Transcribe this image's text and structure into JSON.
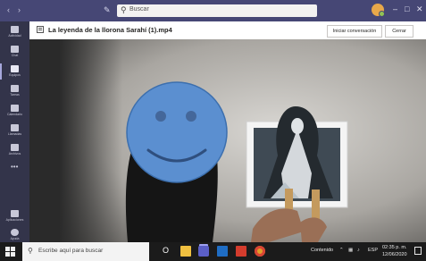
{
  "search": {
    "placeholder": "Buscar"
  },
  "rail": {
    "items": [
      {
        "label": "Actividad"
      },
      {
        "label": "Chat"
      },
      {
        "label": "Equipos"
      },
      {
        "label": "Tareas"
      },
      {
        "label": "Calendario"
      },
      {
        "label": "Llamadas"
      },
      {
        "label": "Archivos"
      }
    ],
    "more": "•••",
    "bottom": [
      {
        "label": "Aplicaciones"
      },
      {
        "label": "Ayuda"
      }
    ]
  },
  "header": {
    "title": "La leyenda de la llorona Sarahí (1).mp4",
    "start_conversation_label": "Iniciar conversación",
    "close_label": "Cerrar"
  },
  "taskbar": {
    "search_placeholder": "Escribe aquí para buscar",
    "cortana": "O",
    "tray_text": "Contenido",
    "language": "ESP",
    "time": "02:35 p. m.",
    "date": "12/06/2020"
  },
  "colors": {
    "title_bar": "#464775",
    "rail": "#33344a",
    "taskbar": "#1b1b1b",
    "smiley": "#5b8fd0"
  }
}
